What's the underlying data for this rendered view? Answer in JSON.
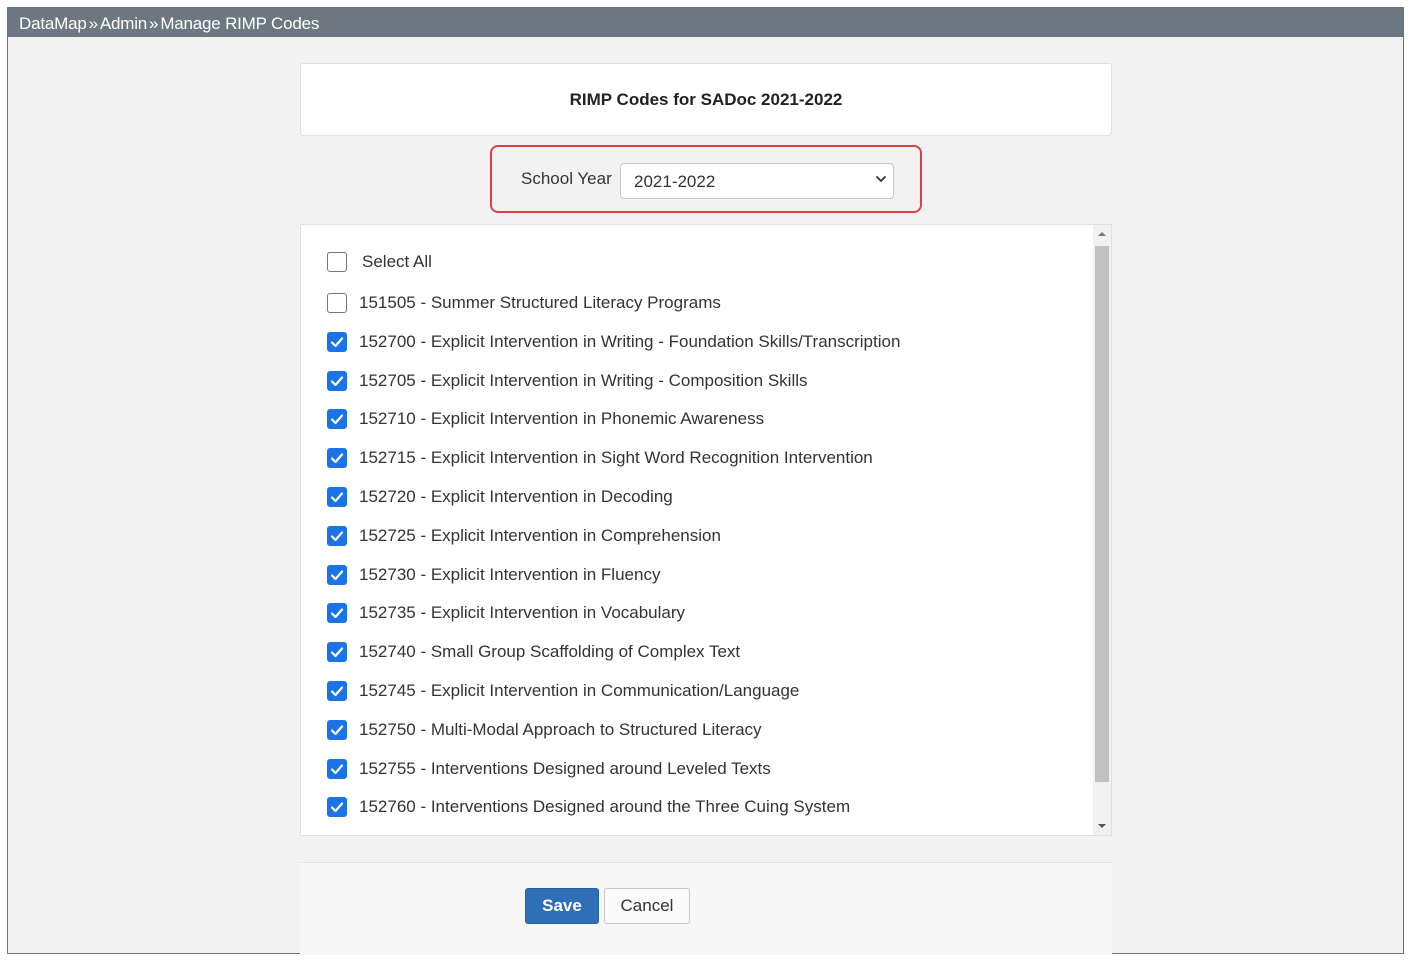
{
  "breadcrumb": {
    "items": [
      "DataMap",
      "Admin",
      "Manage RIMP Codes"
    ],
    "separator": "»"
  },
  "page_title": "RIMP Codes for SADoc 2021-2022",
  "school_year": {
    "label": "School Year",
    "selected": "2021-2022"
  },
  "select_all": {
    "label": "Select All",
    "checked": false
  },
  "codes": [
    {
      "label": "151505 - Summer Structured Literacy Programs",
      "checked": false
    },
    {
      "label": "152700 - Explicit Intervention in Writing - Foundation Skills/Transcription",
      "checked": true
    },
    {
      "label": "152705 - Explicit Intervention in Writing - Composition Skills",
      "checked": true
    },
    {
      "label": "152710 - Explicit Intervention in Phonemic Awareness",
      "checked": true
    },
    {
      "label": "152715 - Explicit Intervention in Sight Word Recognition Intervention",
      "checked": true
    },
    {
      "label": "152720 - Explicit Intervention in Decoding",
      "checked": true
    },
    {
      "label": "152725 - Explicit Intervention in Comprehension",
      "checked": true
    },
    {
      "label": "152730 - Explicit Intervention in Fluency",
      "checked": true
    },
    {
      "label": "152735 - Explicit Intervention in Vocabulary",
      "checked": true
    },
    {
      "label": "152740 - Small Group Scaffolding of Complex Text",
      "checked": true
    },
    {
      "label": "152745 - Explicit Intervention in Communication/Language",
      "checked": true
    },
    {
      "label": "152750 - Multi-Modal Approach to Structured Literacy",
      "checked": true
    },
    {
      "label": "152755 - Interventions Designed around Leveled Texts",
      "checked": true
    },
    {
      "label": "152760 - Interventions Designed around the Three Cuing System",
      "checked": true
    }
  ],
  "buttons": {
    "save": "Save",
    "cancel": "Cancel"
  },
  "colors": {
    "topbar": "#6c7782",
    "checkbox_checked": "#1a73e8",
    "save_button": "#2e6fb5",
    "highlight_border": "#e0404a"
  },
  "icons": {
    "dropdown": "chevron-down-icon",
    "checkmark": "checkmark-icon",
    "scroll_up": "scroll-up-arrow-icon",
    "scroll_down": "scroll-down-arrow-icon"
  }
}
